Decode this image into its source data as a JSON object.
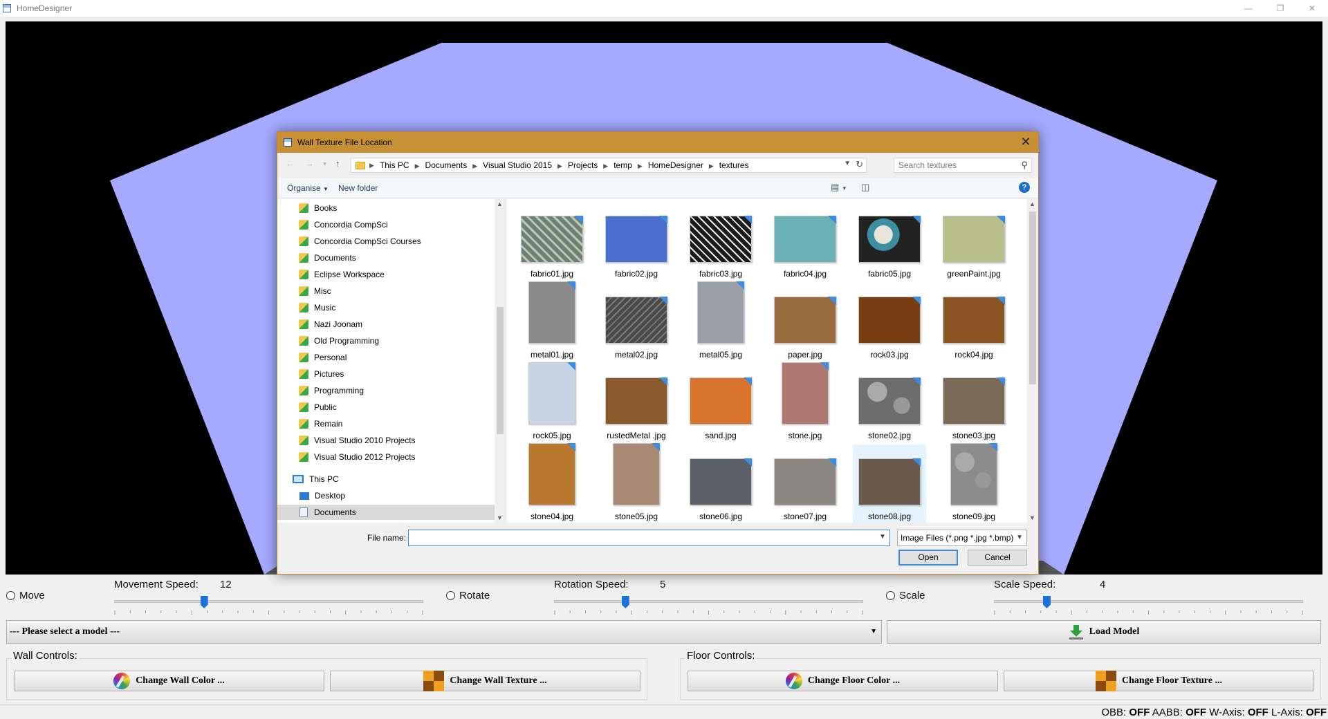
{
  "app": {
    "title": "HomeDesigner"
  },
  "dialog": {
    "title": "Wall Texture File Location",
    "breadcrumb": [
      "This PC",
      "Documents",
      "Visual Studio 2015",
      "Projects",
      "temp",
      "HomeDesigner",
      "textures"
    ],
    "search_placeholder": "Search textures",
    "organise_label": "Organise",
    "new_folder_label": "New folder",
    "nav_items": [
      {
        "label": "Books",
        "icon": "library-icon"
      },
      {
        "label": "Concordia CompSci",
        "icon": "library-icon"
      },
      {
        "label": "Concordia CompSci Courses",
        "icon": "library-icon"
      },
      {
        "label": "Documents",
        "icon": "library-icon"
      },
      {
        "label": "Eclipse Workspace",
        "icon": "library-icon"
      },
      {
        "label": "Misc",
        "icon": "library-icon"
      },
      {
        "label": "Music",
        "icon": "library-icon"
      },
      {
        "label": "Nazi Joonam",
        "icon": "library-icon"
      },
      {
        "label": "Old Programming",
        "icon": "library-icon"
      },
      {
        "label": "Personal",
        "icon": "library-icon"
      },
      {
        "label": "Pictures",
        "icon": "library-icon"
      },
      {
        "label": "Programming",
        "icon": "library-icon"
      },
      {
        "label": "Public",
        "icon": "library-icon"
      },
      {
        "label": "Remain",
        "icon": "library-icon"
      },
      {
        "label": "Visual Studio 2010 Projects",
        "icon": "library-icon"
      },
      {
        "label": "Visual Studio 2012 Projects",
        "icon": "library-icon"
      }
    ],
    "this_pc": {
      "label": "This PC",
      "children": [
        {
          "label": "Desktop",
          "icon": "desktop-icon"
        },
        {
          "label": "Documents",
          "icon": "documents-icon",
          "selected": true
        }
      ]
    },
    "files": [
      {
        "name": "fabric01.jpg",
        "color": "#6f7f73",
        "pattern": "stripes"
      },
      {
        "name": "fabric02.jpg",
        "color": "#4a6fcf"
      },
      {
        "name": "fabric03.jpg",
        "color": "#1a1a1a",
        "pattern": "diamonds"
      },
      {
        "name": "fabric04.jpg",
        "color": "#6ab0b5"
      },
      {
        "name": "fabric05.jpg",
        "color": "#3b8fa0",
        "pattern": "paisley"
      },
      {
        "name": "greenPaint.jpg",
        "color": "#b8bf8a"
      },
      {
        "name": "metal01.jpg",
        "color": "#8a8a8a"
      },
      {
        "name": "metal02.jpg",
        "color": "#5c5c5c",
        "pattern": "tread"
      },
      {
        "name": "metal05.jpg",
        "color": "#9aa0a8"
      },
      {
        "name": "paper.jpg",
        "color": "#9a6a3f"
      },
      {
        "name": "rock03.jpg",
        "color": "#7a3d12"
      },
      {
        "name": "rock04.jpg",
        "color": "#8a5522"
      },
      {
        "name": "rock05.jpg",
        "color": "#c9d3e6"
      },
      {
        "name": "rustedMetal .jpg",
        "color": "#8a5a2c"
      },
      {
        "name": "sand.jpg",
        "color": "#d8742c"
      },
      {
        "name": "stone.jpg",
        "color": "#b07872"
      },
      {
        "name": "stone02.jpg",
        "color": "#6d6d6d",
        "pattern": "pebbles"
      },
      {
        "name": "stone03.jpg",
        "color": "#7a6a58"
      },
      {
        "name": "stone04.jpg",
        "color": "#b8782e"
      },
      {
        "name": "stone05.jpg",
        "color": "#a88a74"
      },
      {
        "name": "stone06.jpg",
        "color": "#5a6068"
      },
      {
        "name": "stone07.jpg",
        "color": "#8a8680"
      },
      {
        "name": "stone08.jpg",
        "color": "#6a5a4e",
        "selected": true
      },
      {
        "name": "stone09.jpg",
        "color": "#8c8c8c",
        "pattern": "pebbles"
      }
    ],
    "file_name_label": "File name:",
    "file_name_value": "",
    "filter": "Image Files (*.png *.jpg *.bmp)",
    "open_label": "Open",
    "cancel_label": "Cancel"
  },
  "controls": {
    "move_label": "Move",
    "movement_speed_label": "Movement Speed:",
    "movement_speed_value": "12",
    "movement_slider_fraction": 0.29,
    "rotate_label": "Rotate",
    "rotation_speed_label": "Rotation Speed:",
    "rotation_speed_value": "5",
    "rotation_slider_fraction": 0.23,
    "scale_label": "Scale",
    "scale_speed_label": "Scale Speed:",
    "scale_speed_value": "4",
    "scale_slider_fraction": 0.17,
    "model_select": "--- Please select a model ---",
    "load_model_label": "Load Model",
    "wall_controls_label": "Wall Controls:",
    "change_wall_color": "Change Wall Color ...",
    "change_wall_texture": "Change Wall Texture ...",
    "floor_controls_label": "Floor Controls:",
    "change_floor_color": "Change Floor Color ...",
    "change_floor_texture": "Change Floor Texture ..."
  },
  "status": {
    "obb_label": "OBB:",
    "obb_value": "OFF",
    "aabb_label": "AABB:",
    "aabb_value": "OFF",
    "waxis_label": "W-Axis:",
    "waxis_value": "OFF",
    "laxis_label": "L-Axis:",
    "laxis_value": "OFF"
  },
  "colors": {
    "wall": "#a6aaff",
    "dialog_title": "#c89035",
    "accent": "#1a73d9"
  }
}
